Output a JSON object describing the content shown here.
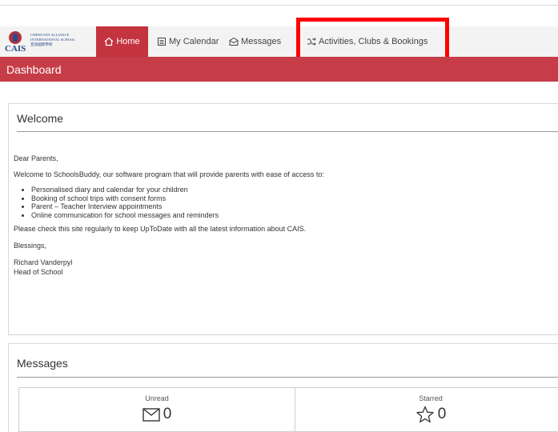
{
  "school": {
    "initials": "CAIS",
    "name": "CHRISTIAN ALLIANCE\nINTERNATIONAL SCHOOL\n宣道國際學校"
  },
  "nav": {
    "items": [
      {
        "label": "Home",
        "icon": "home-icon",
        "active": true
      },
      {
        "label": "My Calendar",
        "icon": "calendar-icon",
        "active": false
      },
      {
        "label": "Messages",
        "icon": "message-icon",
        "active": false
      },
      {
        "label": "Activities, Clubs & Bookings",
        "icon": "activities-icon",
        "active": false
      }
    ]
  },
  "header": {
    "title": "Dashboard"
  },
  "welcome": {
    "title": "Welcome",
    "greeting": "Dear Parents,",
    "intro": "Welcome to SchoolsBuddy, our software program that will provide parents with ease of access to:",
    "bullets": [
      "Personalised diary and calendar for your children",
      "Booking of school trips with consent forms",
      "Parent – Teacher Interview appointments",
      "Online communication for school messages and reminders"
    ],
    "reminder": "Please check this site regularly to keep UpToDate with all the latest information about CAIS.",
    "closing": "Blessings,",
    "signature_name": "Richard Vanderpyl",
    "signature_title": "Head of School"
  },
  "messages": {
    "title": "Messages",
    "unread_label": "Unread",
    "unread_count": "0",
    "starred_label": "Starred",
    "starred_count": "0"
  },
  "colors": {
    "accent": "#c63c47",
    "nav_bg": "#f3f3f3",
    "highlight": "#ff0000"
  }
}
